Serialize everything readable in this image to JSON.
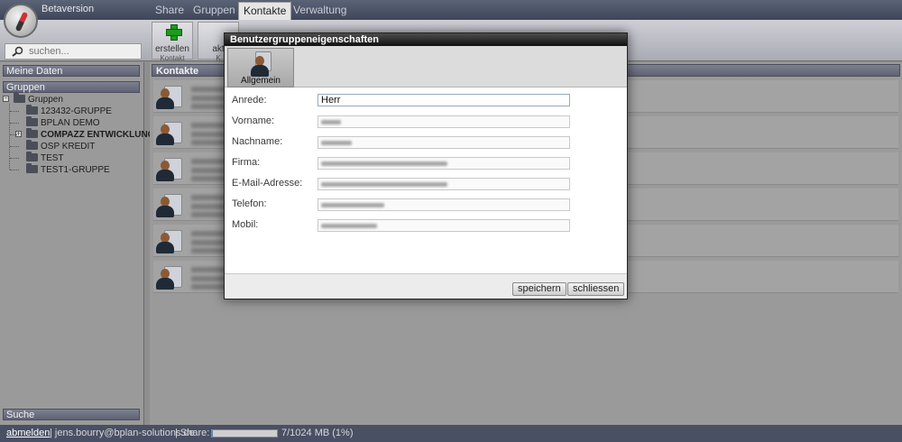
{
  "app": {
    "version_label": "Betaversion"
  },
  "nav": {
    "tabs": [
      {
        "label": "Share"
      },
      {
        "label": "Gruppen"
      },
      {
        "label": "Kontakte"
      },
      {
        "label": "Verwaltung"
      }
    ],
    "active_tab": "Kontakte"
  },
  "search": {
    "placeholder": "suchen..."
  },
  "toolbar": {
    "create_label": "erstellen",
    "create_sub": "Kontakt",
    "update_label": "akt",
    "update_sub": "K"
  },
  "sidebar": {
    "my_data_header": "Meine Daten",
    "groups_header": "Gruppen",
    "search_header": "Suche",
    "tree_root": "Gruppen",
    "groups": [
      {
        "label": "123432-GRUPPE",
        "bold": false
      },
      {
        "label": "BPLAN DEMO",
        "bold": false
      },
      {
        "label": "COMPAZZ ENTWICKLUNG",
        "bold": true
      },
      {
        "label": "OSP KREDIT",
        "bold": false
      },
      {
        "label": "TEST",
        "bold": false
      },
      {
        "label": "TEST1-GRUPPE",
        "bold": false
      }
    ]
  },
  "main": {
    "header": "Kontakte",
    "contact_count": 6
  },
  "dialog": {
    "title": "Benutzergruppeneigenschaften",
    "tab_label": "Allgemein",
    "fields": [
      {
        "label": "Anrede:",
        "value": "Herr"
      },
      {
        "label": "Vorname:",
        "value": ""
      },
      {
        "label": "Nachname:",
        "value": ""
      },
      {
        "label": "Firma:",
        "value": ""
      },
      {
        "label": "E-Mail-Adresse:",
        "value": ""
      },
      {
        "label": "Telefon:",
        "value": ""
      },
      {
        "label": "Mobil:",
        "value": ""
      }
    ],
    "save_label": "speichern",
    "close_label": "schliessen"
  },
  "footer": {
    "logout_label": "abmelden",
    "user_email": "| jens.bourry@bplan-solutions.de",
    "share_label": "| Share:",
    "share_usage": "7/1024 MB (1%)",
    "share_fraction": 0.01
  }
}
